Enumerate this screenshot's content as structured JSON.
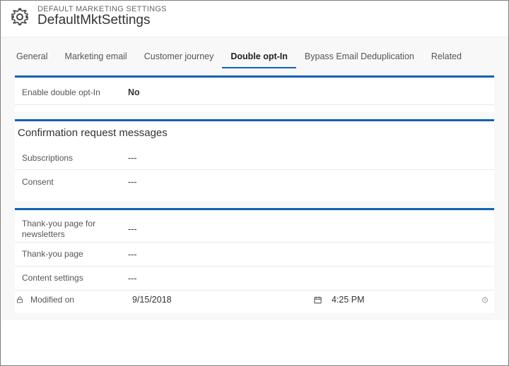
{
  "header": {
    "subtitle": "DEFAULT MARKETING SETTINGS",
    "title": "DefaultMktSettings"
  },
  "tabs": {
    "general": "General",
    "marketing_email": "Marketing email",
    "customer_journey": "Customer journey",
    "double_opt_in": "Double opt-In",
    "bypass_dedup": "Bypass Email Deduplication",
    "related": "Related"
  },
  "section1": {
    "enable_label": "Enable double opt-In",
    "enable_value": "No"
  },
  "section2": {
    "title": "Confirmation request messages",
    "subscriptions_label": "Subscriptions",
    "subscriptions_value": "---",
    "consent_label": "Consent",
    "consent_value": "---"
  },
  "section3": {
    "thankyou_news_label": "Thank-you page for newsletters",
    "thankyou_news_value": "---",
    "thankyou_label": "Thank-you page",
    "thankyou_value": "---",
    "content_settings_label": "Content settings",
    "content_settings_value": "---",
    "modified_label": "Modified on",
    "modified_date": "9/15/2018",
    "modified_time": "4:25 PM"
  }
}
